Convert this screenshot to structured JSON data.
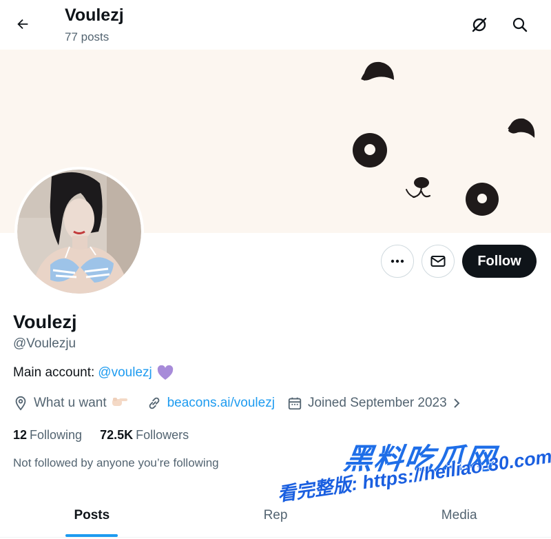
{
  "header": {
    "title": "Voulezj",
    "posts_count": "77 posts",
    "back_icon": "arrow-left-icon",
    "grok_icon": "grok-icon",
    "search_icon": "search-icon"
  },
  "banner": {
    "background": "#fcf6f0",
    "description": "panda face drawing"
  },
  "profile": {
    "display_name": "Voulezj",
    "handle": "@Voulezju",
    "bio_prefix": "Main account:",
    "bio_link": "@voulezj",
    "bio_emoji": "purple-heart",
    "location": "What u want",
    "location_emoji": "pointing-finger",
    "website": "beacons.ai/voulezj",
    "joined": "Joined September 2023",
    "following_count": "12",
    "following_label": "Following",
    "followers_count": "72.5K",
    "followers_label": "Followers",
    "followed_note": "Not followed by anyone you’re following"
  },
  "actions": {
    "more_icon": "more-icon",
    "message_icon": "mail-icon",
    "follow_label": "Follow"
  },
  "tabs": [
    {
      "label": "Posts",
      "active": true
    },
    {
      "label": "Rep",
      "active": false
    },
    {
      "label": "Media",
      "active": false
    }
  ],
  "watermark": {
    "line1": "黑料吃瓜网",
    "line2": "看完整版: https://heiliao-30.com"
  },
  "colors": {
    "accent": "#1d9bf0",
    "text_primary": "#0f1419",
    "text_secondary": "#536471",
    "heart": "#a78bd9"
  }
}
